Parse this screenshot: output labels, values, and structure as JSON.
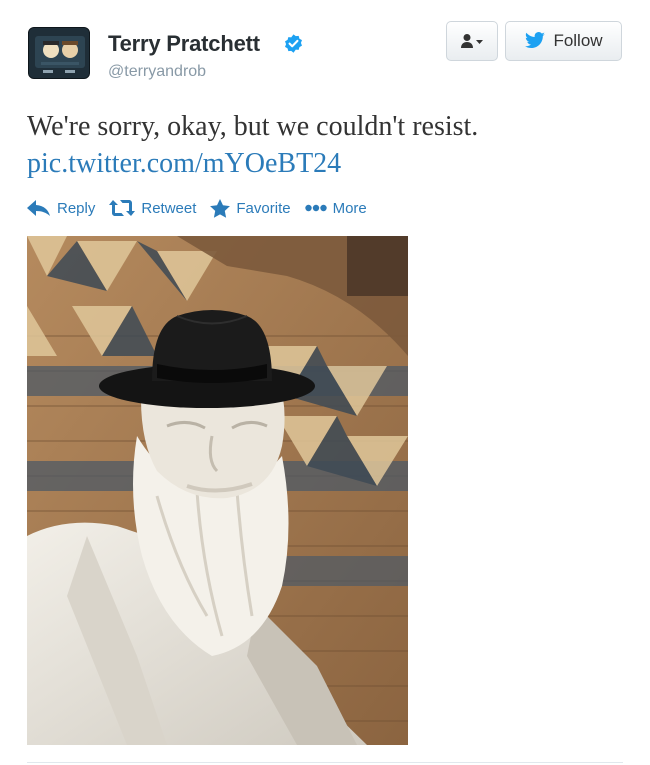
{
  "tweet": {
    "author_name": "Terry Pratchett",
    "handle": "@terryandrob",
    "text": "We're sorry, okay, but we couldn't resist.",
    "link": "pic.twitter.com/mYOeBT24",
    "verified": true
  },
  "buttons": {
    "user_menu_icon": "person-icon",
    "follow_label": "Follow"
  },
  "actions": {
    "reply_label": "Reply",
    "retweet_label": "Retweet",
    "favorite_label": "Favorite",
    "more_label": "More"
  },
  "colors": {
    "link": "#2b7bb9",
    "verified": "#1da1f2",
    "follow_bird": "#1da1f2"
  }
}
